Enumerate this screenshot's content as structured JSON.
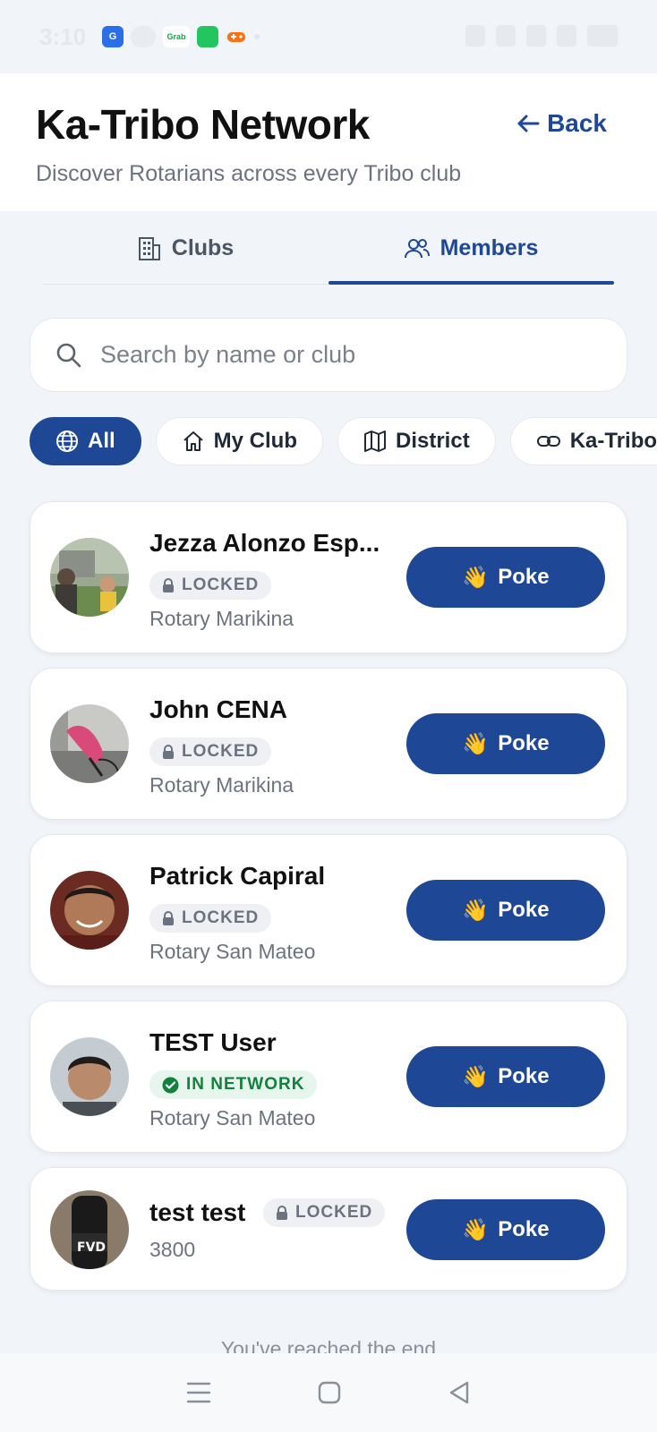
{
  "status": {
    "time": "3:10",
    "apps": [
      {
        "name": "g-app-icon",
        "label": "G",
        "color": "#2b6fe8"
      },
      {
        "name": "pill-icon",
        "label": "",
        "color": "#e8ebf0"
      },
      {
        "name": "grab-icon",
        "label": "Grab",
        "color": "#ffffff"
      },
      {
        "name": "green-app-icon",
        "label": "",
        "color": "#22c55e"
      },
      {
        "name": "game-icon",
        "label": "",
        "color": "#f97316"
      }
    ]
  },
  "header": {
    "title": "Ka-Tribo Network",
    "subtitle": "Discover Rotarians across every Tribo club",
    "back_label": "Back"
  },
  "tabs": [
    {
      "label": "Clubs",
      "icon": "building-icon",
      "active": false
    },
    {
      "label": "Members",
      "icon": "people-icon",
      "active": true
    }
  ],
  "search": {
    "placeholder": "Search by name or club",
    "value": ""
  },
  "filters": [
    {
      "label": "All",
      "icon": "globe-icon",
      "active": true
    },
    {
      "label": "My Club",
      "icon": "home-icon",
      "active": false
    },
    {
      "label": "District",
      "icon": "map-icon",
      "active": false
    },
    {
      "label": "Ka-Tribo",
      "icon": "link-icon",
      "active": false
    }
  ],
  "members": [
    {
      "name": "Jezza Alonzo Esp...",
      "status": "LOCKED",
      "club": "Rotary Marikina",
      "poke_label": "Poke"
    },
    {
      "name": "John CENA",
      "status": "LOCKED",
      "club": "Rotary Marikina",
      "poke_label": "Poke"
    },
    {
      "name": "Patrick Capiral",
      "status": "LOCKED",
      "club": "Rotary San Mateo",
      "poke_label": "Poke"
    },
    {
      "name": "TEST User",
      "status": "IN NETWORK",
      "club": "Rotary San Mateo",
      "poke_label": "Poke"
    },
    {
      "name": "test test",
      "status": "LOCKED",
      "club": "3800",
      "poke_label": "Poke"
    }
  ],
  "end_text": "You've reached the end",
  "colors": {
    "primary": "#1e4796",
    "background": "#f1f4f9",
    "locked_badge": "#eef0f3",
    "network_badge": "#e6f6ec",
    "network_text": "#15803d"
  }
}
